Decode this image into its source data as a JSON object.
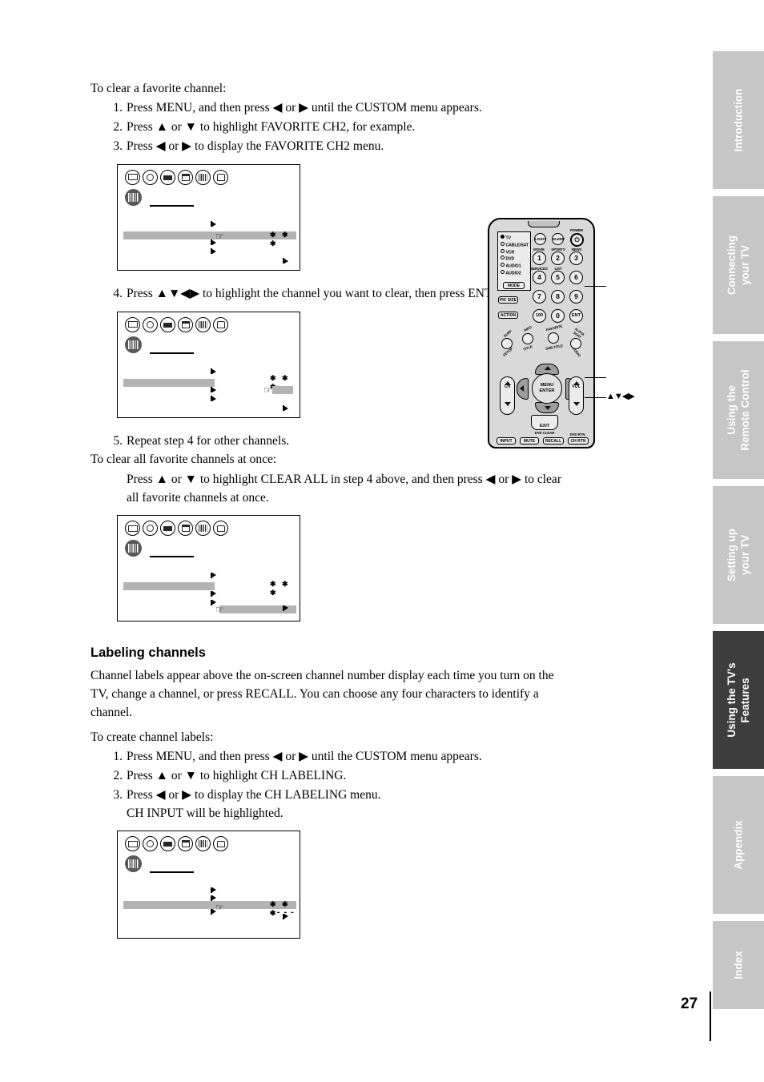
{
  "page": {
    "number": "27"
  },
  "section_a": {
    "lead": "To clear a favorite channel:",
    "steps": [
      {
        "num": "1.",
        "text": "Press MENU, and then press ◀ or ▶ until the CUSTOM menu appears."
      },
      {
        "num": "2.",
        "text": "Press ▲ or ▼ to highlight FAVORITE CH2, for example."
      },
      {
        "num": "3.",
        "text": "Press ◀ or ▶ to display the FAVORITE CH2 menu."
      },
      {
        "num": "4.",
        "text": "Press ▲▼◀▶ to highlight the channel you want to clear, then press ENTER."
      },
      {
        "num": "5.",
        "text": "Repeat step 4 for other channels."
      }
    ],
    "clear_all_lead": "To clear all favorite channels at once:",
    "clear_all_text": "Press ▲ or ▼ to highlight CLEAR ALL in step 4 above, and then press ◀ or ▶ to clear all favorite channels at once."
  },
  "section_b": {
    "heading": "Labeling channels",
    "intro": "Channel labels appear above the on-screen channel number display each time you turn on the TV, change a channel, or press RECALL. You can choose any four characters to identify a channel.",
    "lead": "To create channel labels:",
    "steps": [
      {
        "num": "1.",
        "text": "Press MENU, and then press ◀ or ▶ until the CUSTOM menu appears."
      },
      {
        "num": "2.",
        "text": "Press ▲ or ▼ to highlight CH LABELING."
      },
      {
        "num": "3.",
        "text": "Press ◀ or ▶ to display the CH LABELING menu."
      }
    ],
    "note": "CH INPUT will be highlighted."
  },
  "osd": {
    "icon_names": [
      "picture-icon",
      "audio-icon",
      "video-icon",
      "setup-icon",
      "custom-icon",
      "lock-icon"
    ],
    "stars": "✱ ✱ ✱",
    "dashes": "- - - -"
  },
  "remote": {
    "modes": [
      "TV",
      "CABLE/SAT",
      "VCR",
      "DVD",
      "AUDIO1",
      "AUDIO2"
    ],
    "mode_button": "MODE",
    "pic_size_button": "PIC SIZE",
    "action_button": "ACTION",
    "light_button": "LIGHT",
    "sleep_button": "SLEEP",
    "power_label": "POWER",
    "number_keys": [
      {
        "key": "1",
        "label": "MOVIE"
      },
      {
        "key": "2",
        "label": "SPORTS"
      },
      {
        "key": "3",
        "label": "NEWS"
      },
      {
        "key": "4",
        "label": "SERVICES"
      },
      {
        "key": "5",
        "label": "LIST"
      },
      {
        "key": "6",
        "label": ""
      },
      {
        "key": "7",
        "label": ""
      },
      {
        "key": "8",
        "label": ""
      },
      {
        "key": "9",
        "label": ""
      },
      {
        "key": "100",
        "label": ""
      },
      {
        "key": "0",
        "label": ""
      },
      {
        "key": "ENT",
        "label": ""
      }
    ],
    "round_buttons": [
      {
        "top": "SURF",
        "bottom": "SETUP"
      },
      {
        "top": "INFO",
        "bottom": "TITLE"
      },
      {
        "top": "FAVORITE",
        "bottom": "SUB TITLE"
      },
      {
        "top": "ALPHA SORT",
        "bottom": "AUDIO"
      }
    ],
    "dpad_center": "MENU\nENTER",
    "ch_rocker": "CH",
    "vol_rocker": "VOL",
    "exit_button": "EXIT",
    "exit_sub": "DVD CLEAR",
    "bottom_buttons": [
      "INPUT",
      "MUTE",
      "RECALL",
      "CH RTN"
    ],
    "ch_rtn_sub": "DVD RTN",
    "callout_arrows": "▲▼◀▶"
  },
  "tabs": [
    {
      "label": "Introduction",
      "active": false
    },
    {
      "label": "Connecting\nyour TV",
      "active": false
    },
    {
      "label": "Using the\nRemote Control",
      "active": false
    },
    {
      "label": "Setting up\nyour TV",
      "active": false
    },
    {
      "label": "Using the TV's\nFeatures",
      "active": true
    },
    {
      "label": "Appendix",
      "active": false
    },
    {
      "label": "Index",
      "active": false
    }
  ],
  "colors": {
    "tab_inactive": "#c6c6c6",
    "tab_active": "#3d3d3d",
    "osd_bar": "#b3b3b3",
    "osd_selected_icon": "#585858"
  }
}
